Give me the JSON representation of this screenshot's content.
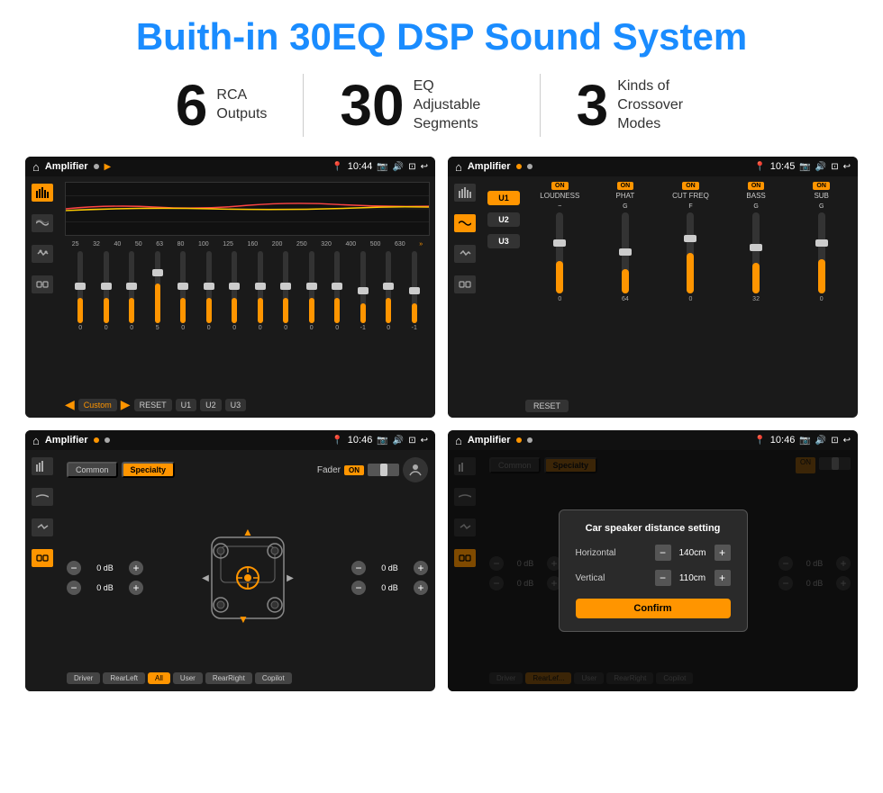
{
  "page": {
    "title": "Buith-in 30EQ DSP Sound System",
    "stats": [
      {
        "number": "6",
        "label": "RCA\nOutputs"
      },
      {
        "number": "30",
        "label": "EQ Adjustable\nSegments"
      },
      {
        "number": "3",
        "label": "Kinds of\nCrossover Modes"
      }
    ]
  },
  "screens": {
    "top_left": {
      "status": {
        "title": "Amplifier",
        "time": "10:44"
      },
      "eq": {
        "frequencies": [
          "25",
          "32",
          "40",
          "50",
          "63",
          "80",
          "100",
          "125",
          "160",
          "200",
          "250",
          "320",
          "400",
          "500",
          "630"
        ],
        "values": [
          "0",
          "0",
          "0",
          "5",
          "0",
          "0",
          "0",
          "0",
          "0",
          "0",
          "0",
          "-1",
          "0",
          "-1"
        ],
        "preset": "Custom",
        "buttons": [
          "RESET",
          "U1",
          "U2",
          "U3"
        ]
      }
    },
    "top_right": {
      "status": {
        "title": "Amplifier",
        "time": "10:45"
      },
      "presets": [
        "U1",
        "U2",
        "U3"
      ],
      "channels": [
        "LOUDNESS",
        "PHAT",
        "CUT FREQ",
        "BASS",
        "SUB"
      ],
      "reset_btn": "RESET"
    },
    "bottom_left": {
      "status": {
        "title": "Amplifier",
        "time": "10:46"
      },
      "tabs": [
        "Common",
        "Specialty"
      ],
      "fader_label": "Fader",
      "fader_on": "ON",
      "db_values": [
        "0 dB",
        "0 dB",
        "0 dB",
        "0 dB"
      ],
      "bottom_buttons": [
        "Driver",
        "RearLeft",
        "All",
        "User",
        "RearRight",
        "Copilot"
      ]
    },
    "bottom_right": {
      "status": {
        "title": "Amplifier",
        "time": "10:46"
      },
      "tabs": [
        "Common",
        "Specialty"
      ],
      "dialog": {
        "title": "Car speaker distance setting",
        "horizontal_label": "Horizontal",
        "horizontal_value": "140cm",
        "vertical_label": "Vertical",
        "vertical_value": "110cm",
        "confirm_label": "Confirm"
      }
    }
  }
}
